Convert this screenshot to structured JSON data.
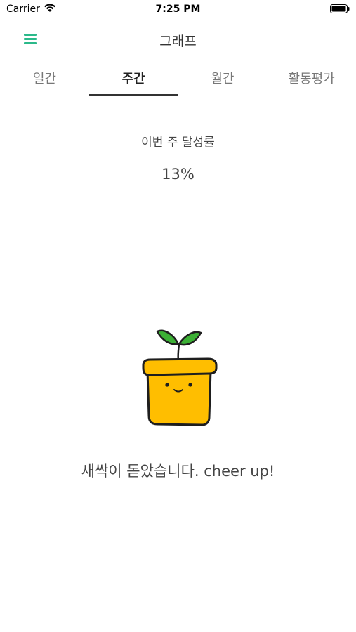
{
  "status_bar": {
    "carrier": "Carrier",
    "time": "7:25 PM"
  },
  "nav": {
    "title": "그래프",
    "menu_icon": "hamburger-menu-icon",
    "accent_color": "#2bb98a"
  },
  "tabs": [
    {
      "label": "일간",
      "active": false
    },
    {
      "label": "주간",
      "active": true
    },
    {
      "label": "월간",
      "active": false
    },
    {
      "label": "활동평가",
      "active": false
    }
  ],
  "stats": {
    "label": "이번 주 달성률",
    "value": "13%"
  },
  "illustration": {
    "name": "sprout-pot-icon",
    "pot_color": "#ffbe00",
    "leaf_color": "#3cb035"
  },
  "message": "새싹이 돋았습니다. cheer up!"
}
